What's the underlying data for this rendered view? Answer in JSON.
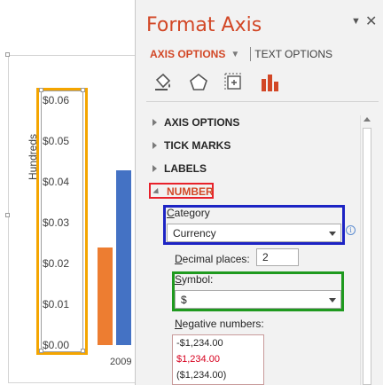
{
  "chart": {
    "y_axis_title": "Hundreds",
    "tick_labels": [
      "$0.06",
      "$0.05",
      "$0.04",
      "$0.03",
      "$0.02",
      "$0.01",
      "$0.00"
    ],
    "x_label_partial": "2009",
    "colors": {
      "orange": "#ed7d31",
      "blue": "#4472c4",
      "axis_highlight": "#f4a500"
    }
  },
  "chart_data": {
    "type": "bar",
    "categories": [
      "2009"
    ],
    "ylabel": "Hundreds",
    "ylim": [
      0,
      0.06
    ],
    "series": [
      {
        "color": "#ed7d31",
        "values": [
          0.024
        ]
      },
      {
        "color": "#4472c4",
        "values": [
          0.043
        ]
      }
    ],
    "tick_labels": [
      "$0.00",
      "$0.01",
      "$0.02",
      "$0.03",
      "$0.04",
      "$0.05",
      "$0.06"
    ]
  },
  "pane": {
    "title": "Format Axis",
    "tab_axis_options": "AXIS OPTIONS",
    "tab_text_options": "TEXT OPTIONS",
    "icons": [
      "fill-line-icon",
      "effects-icon",
      "size-properties-icon",
      "axis-options-icon"
    ],
    "sections": {
      "axis_options": "AXIS OPTIONS",
      "tick_marks": "TICK MARKS",
      "labels": "LABELS",
      "number": "NUMBER"
    },
    "category": {
      "label": "Category",
      "value": "Currency"
    },
    "decimal": {
      "label": "Decimal places:",
      "value": "2"
    },
    "symbol": {
      "label": "Symbol:",
      "value": "$"
    },
    "negative": {
      "label": "Negative numbers:",
      "items": [
        "-$1,234.00",
        "$1,234.00",
        "($1,234.00)"
      ]
    },
    "accent_color": "#d24726",
    "highlight_colors": {
      "number": "#e8212b",
      "category": "#1d24c4",
      "symbol": "#1f9a1f"
    }
  }
}
